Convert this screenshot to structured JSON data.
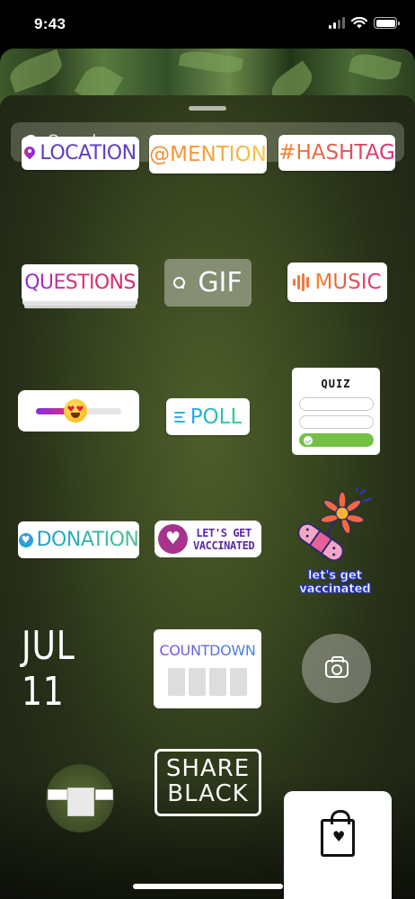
{
  "status_bar": {
    "time": "9:43"
  },
  "search": {
    "placeholder": "Search"
  },
  "stickers": {
    "location": "LOCATION",
    "mention": "@MENTION",
    "hashtag": "#HASHTAG",
    "questions": "QUESTIONS",
    "gif": "GIF",
    "music": "MUSIC",
    "emoji_slider_level": 0.45,
    "poll": "POLL",
    "quiz": {
      "title": "QUIZ",
      "correct_option": 3
    },
    "donation": "DONATION",
    "vaccinated": {
      "line1": "LET'S GET",
      "line2": "VACCINATED"
    },
    "vaccinated_art": {
      "line1": "let's get",
      "line2": "vaccinated"
    },
    "date": "JUL 11",
    "countdown": "COUNTDOWN",
    "share": {
      "line1": "SHARE",
      "line2": "BLACK"
    }
  },
  "colors": {
    "instagram_purple": "#5f3dc4",
    "quiz_correct": "#74c045",
    "donation_blue": "#2aa0dd"
  },
  "icons": [
    "search-icon",
    "pin-icon",
    "gif-search-icon",
    "music-bars-icon",
    "heart-eyes-emoji-icon",
    "poll-lines-icon",
    "check-icon",
    "heart-circle-icon",
    "camera-icon",
    "shopping-bag-icon"
  ]
}
